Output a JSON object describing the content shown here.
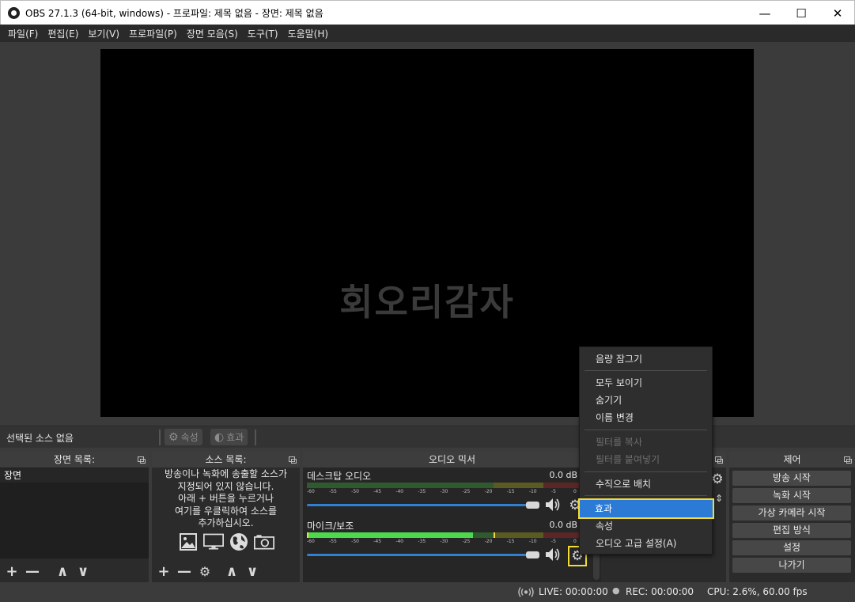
{
  "window": {
    "title": "OBS 27.1.3 (64-bit, windows) - 프로파일: 제목 없음 - 장면: 제목 없음",
    "minimize": "—",
    "maximize": "☐",
    "close": "✕"
  },
  "menubar": [
    "파일(F)",
    "편집(E)",
    "보기(V)",
    "프로파일(P)",
    "장면 모음(S)",
    "도구(T)",
    "도움말(H)"
  ],
  "preview": {
    "watermark": "회오리감자"
  },
  "context_bar": {
    "no_source": "선택된 소스 없음",
    "properties": "속성",
    "filters": "효과"
  },
  "scenes": {
    "header": "장면 목록:",
    "items": [
      "장면"
    ],
    "toolbar": {
      "add": "+",
      "remove": "—",
      "up": "∧",
      "down": "∨"
    }
  },
  "sources": {
    "header": "소스 목록:",
    "hint": "방송이나 녹화에 송출할 소스가\n지정되어 있지 않습니다.\n아래 + 버튼을 누르거나\n여기를 우클릭하여 소스를\n추가하십시오.",
    "toolbar": {
      "add": "+",
      "remove": "—",
      "settings": "⚙",
      "up": "∧",
      "down": "∨"
    }
  },
  "mixer": {
    "header": "오디오 믹서",
    "scale": [
      "-60",
      "-55",
      "-50",
      "-45",
      "-40",
      "-35",
      "-30",
      "-25",
      "-20",
      "-15",
      "-10",
      "-5",
      "0"
    ],
    "channels": [
      {
        "name": "데스크탑 오디오",
        "db": "0.0 dB",
        "level": 0.0
      },
      {
        "name": "마이크/보조",
        "db": "0.0 dB",
        "level": 0.61
      }
    ]
  },
  "controls": {
    "header": "제어",
    "buttons": [
      "방송 시작",
      "녹화 시작",
      "가상 카메라 시작",
      "편집 방식",
      "설정",
      "나가기"
    ]
  },
  "statusbar": {
    "live": "LIVE: 00:00:00",
    "rec": "REC: 00:00:00",
    "cpu": "CPU: 2.6%, 60.00 fps"
  },
  "context_menu": {
    "items": [
      {
        "label": "음량 잠그기",
        "disabled": false
      },
      {
        "label": "모두 보이기",
        "disabled": false
      },
      {
        "label": "숨기기",
        "disabled": false
      },
      {
        "label": "이름 변경",
        "disabled": false
      },
      {
        "label": "필터를 복사",
        "disabled": true
      },
      {
        "label": "필터를 붙여넣기",
        "disabled": true
      },
      {
        "label": "수직으로 배치",
        "disabled": false
      },
      {
        "label": "효과",
        "disabled": false,
        "highlighted": true
      },
      {
        "label": "속성",
        "disabled": false
      },
      {
        "label": "오디오 고급 설정(A)",
        "disabled": false
      }
    ]
  },
  "colors": {
    "accent": "#2b7bd6",
    "highlight_box": "#f3dc3a",
    "meter_green": "#4cd94c",
    "meter_yellow": "#c9c93a",
    "meter_red": "#d94c4c"
  }
}
